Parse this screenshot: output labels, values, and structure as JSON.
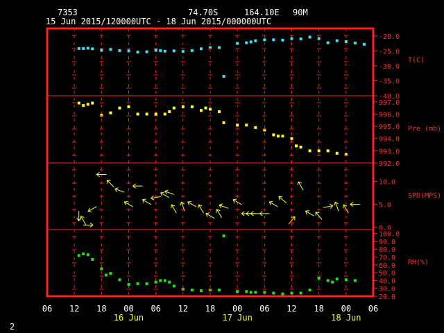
{
  "header": {
    "station_id": "7353",
    "latitude": "74.70S",
    "longitude": "164.10E",
    "height": "90M",
    "time_range": "15 Jun 2015/120000UTC - 18 Jun 2015/000000UTC"
  },
  "footer": {
    "page_number": "2"
  },
  "colors": {
    "frame": "#ff2020",
    "grid": "#ff2020",
    "axis_text": "#ff3030",
    "header_text": "#ffffff",
    "temperature": "#40e0f0",
    "pressure": "#ffff30",
    "wind": "#ffff30",
    "humidity": "#20e020"
  },
  "chart_data": [
    {
      "type": "scatter",
      "name": "temperature-panel",
      "ylabel": "T(C)",
      "ylim": [
        -40,
        -17.5
      ],
      "yticks": [
        -20.0,
        -25.0,
        -30.0,
        -35.0,
        -40.0
      ],
      "ytick_labels": [
        "-20.0",
        "-25.0",
        "-30.0",
        "-35.0",
        "-40.0"
      ],
      "x_hours": [
        13,
        14,
        15,
        16,
        18,
        20,
        22,
        24,
        26,
        28,
        30,
        31,
        32,
        34,
        36,
        38,
        40,
        42,
        44,
        45,
        48,
        50,
        51,
        52,
        54,
        56,
        58,
        60,
        62,
        64,
        66,
        68,
        70,
        72,
        74,
        76
      ],
      "values": [
        -24.2,
        -24.2,
        -24.1,
        -24.3,
        -24.8,
        -24.5,
        -24.9,
        -25.0,
        -25.4,
        -25.3,
        -24.8,
        -24.9,
        -25.1,
        -25.0,
        -25.2,
        -24.9,
        -24.3,
        -23.9,
        -23.9,
        -33.5,
        -22.5,
        -22.3,
        -22.0,
        -21.6,
        -21.3,
        -21.3,
        -21.4,
        -20.9,
        -21.0,
        -20.4,
        -20.9,
        -22.3,
        -21.6,
        -21.9,
        -22.4,
        -22.8
      ]
    },
    {
      "type": "scatter",
      "name": "pressure-panel",
      "ylabel": "Pre (mb)",
      "ylim": [
        992.0,
        997.5
      ],
      "yticks": [
        997.0,
        996.0,
        995.0,
        994.0,
        993.0,
        992.0
      ],
      "ytick_labels": [
        "997.0",
        "996.0",
        "995.0",
        "994.0",
        "993.0",
        "992.0"
      ],
      "x_hours": [
        13,
        14,
        15,
        16,
        18,
        20,
        22,
        24,
        26,
        28,
        30,
        32,
        33,
        34,
        36,
        38,
        40,
        41,
        42,
        44,
        45,
        48,
        50,
        52,
        54,
        56,
        57,
        58,
        60,
        61,
        62,
        64,
        66,
        68,
        70,
        72
      ],
      "values": [
        996.9,
        996.7,
        996.8,
        996.9,
        995.9,
        996.1,
        996.5,
        996.6,
        996.0,
        996.0,
        996.0,
        996.0,
        996.2,
        996.5,
        996.6,
        996.6,
        996.3,
        996.5,
        996.4,
        996.2,
        995.3,
        995.1,
        995.1,
        994.9,
        994.7,
        994.3,
        994.2,
        994.2,
        994.0,
        993.4,
        993.3,
        993.0,
        993.0,
        993.0,
        992.8,
        992.7
      ]
    },
    {
      "type": "vector",
      "name": "wind-panel",
      "ylabel": "SPD(MPS)",
      "ylim": [
        -0.5,
        14
      ],
      "yticks": [
        10.0,
        5.0,
        0.0
      ],
      "ytick_labels": [
        "10.0",
        "5.0",
        "0.0"
      ],
      "x_hours": [
        13,
        14,
        15,
        16,
        18,
        20,
        22,
        24,
        26,
        28,
        30,
        32,
        33,
        34,
        36,
        38,
        40,
        42,
        44,
        45,
        48,
        50,
        51,
        52,
        54,
        56,
        58,
        60,
        62,
        64,
        66,
        68,
        70,
        72,
        74
      ],
      "speed": [
        2.5,
        1.5,
        0.5,
        4.0,
        11.5,
        9.5,
        8.0,
        5.0,
        9.0,
        5.5,
        6.5,
        7.0,
        7.5,
        4.0,
        4.5,
        5.0,
        4.0,
        2.5,
        3.0,
        4.5,
        5.5,
        3.0,
        3.0,
        3.0,
        3.0,
        5.0,
        6.0,
        1.5,
        9.0,
        3.0,
        2.5,
        4.5,
        4.5,
        4.0,
        5.0
      ],
      "direction_deg": [
        180,
        330,
        90,
        240,
        270,
        315,
        290,
        300,
        270,
        300,
        260,
        300,
        290,
        330,
        340,
        300,
        330,
        300,
        330,
        290,
        300,
        270,
        270,
        270,
        270,
        300,
        310,
        40,
        330,
        300,
        320,
        80,
        340,
        330,
        270
      ]
    },
    {
      "type": "scatter",
      "name": "humidity-panel",
      "ylabel": "RH(%)",
      "ylim": [
        20,
        105
      ],
      "yticks": [
        100.0,
        90.0,
        80.0,
        70.0,
        60.0,
        50.0,
        40.0,
        30.0,
        20.0
      ],
      "ytick_labels": [
        "100.0",
        "90.0",
        "80.0",
        "70.0",
        "60.0",
        "50.0",
        "40.0",
        "30.0",
        "20.0"
      ],
      "x_hours": [
        13,
        14,
        15,
        16,
        18,
        19,
        20,
        22,
        24,
        26,
        28,
        30,
        31,
        32,
        33,
        34,
        36,
        38,
        40,
        42,
        44,
        45,
        48,
        50,
        51,
        52,
        54,
        56,
        58,
        60,
        62,
        64,
        66,
        68,
        69,
        70,
        72,
        74
      ],
      "values": [
        72,
        74,
        73,
        67,
        55,
        47,
        49,
        41,
        35,
        36,
        36,
        38,
        40,
        40,
        38,
        33,
        29,
        28,
        27,
        28,
        28,
        97,
        26,
        26,
        25,
        25,
        25,
        24,
        23,
        24,
        24,
        28,
        43,
        40,
        38,
        42,
        41,
        40
      ]
    }
  ],
  "x_axis": {
    "xlim": [
      6,
      78
    ],
    "tick_hours": [
      6,
      12,
      18,
      24,
      30,
      36,
      42,
      48,
      54,
      60,
      66,
      72,
      78
    ],
    "tick_labels": [
      "06",
      "12",
      "18",
      "00",
      "06",
      "12",
      "18",
      "00",
      "06",
      "12",
      "18",
      "00",
      "06"
    ],
    "date_label_hours": [
      24,
      48,
      72
    ],
    "date_labels": [
      "16 Jun",
      "17 Jun",
      "18 Jun"
    ]
  }
}
